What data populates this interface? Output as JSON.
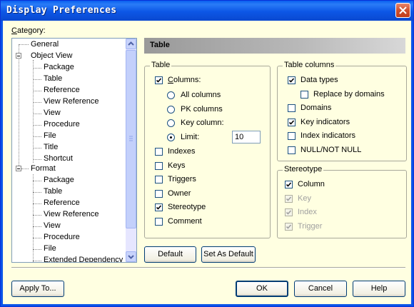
{
  "window": {
    "title": "Display Preferences"
  },
  "category_label": "Category:",
  "tree": {
    "general": "General",
    "object_view": "Object View",
    "object_view_items": [
      "Package",
      "Table",
      "Reference",
      "View Reference",
      "View",
      "Procedure",
      "File",
      "Title",
      "Shortcut"
    ],
    "format": "Format",
    "format_items": [
      "Package",
      "Table",
      "Reference",
      "View Reference",
      "View",
      "Procedure",
      "File",
      "Extended Dependency"
    ]
  },
  "header": {
    "title": "Table"
  },
  "table_group": {
    "title": "Table",
    "columns": {
      "label": "Columns:",
      "checked": true
    },
    "radios": [
      {
        "label": "All columns",
        "selected": false
      },
      {
        "label": "PK columns",
        "selected": false
      },
      {
        "label": "Key column:",
        "selected": false
      },
      {
        "label": "Limit:",
        "selected": true
      }
    ],
    "limit_value": "10",
    "checks": [
      {
        "label": "Indexes",
        "checked": false
      },
      {
        "label": "Keys",
        "checked": false
      },
      {
        "label": "Triggers",
        "checked": false
      },
      {
        "label": "Owner",
        "checked": false
      },
      {
        "label": "Stereotype",
        "checked": true
      },
      {
        "label": "Comment",
        "checked": false
      }
    ]
  },
  "table_columns_group": {
    "title": "Table columns",
    "checks": [
      {
        "label": "Data types",
        "checked": true
      },
      {
        "label": "Replace by domains",
        "checked": false
      },
      {
        "label": "Domains",
        "checked": false
      },
      {
        "label": "Key indicators",
        "checked": true
      },
      {
        "label": "Index indicators",
        "checked": false
      },
      {
        "label": "NULL/NOT NULL",
        "checked": false
      }
    ]
  },
  "stereotype_group": {
    "title": "Stereotype",
    "checks": [
      {
        "label": "Column",
        "checked": true,
        "enabled": true
      },
      {
        "label": "Key",
        "checked": true,
        "enabled": false
      },
      {
        "label": "Index",
        "checked": true,
        "enabled": false
      },
      {
        "label": "Trigger",
        "checked": true,
        "enabled": false
      }
    ]
  },
  "buttons": {
    "default": "Default",
    "set_as_default": "Set As Default",
    "apply_to": "Apply To...",
    "ok": "OK",
    "cancel": "Cancel",
    "help": "Help"
  },
  "colors": {
    "titlebar": "#0a54e8",
    "client_bg": "#ffffe1",
    "header_bar": "#a8a8a8"
  }
}
